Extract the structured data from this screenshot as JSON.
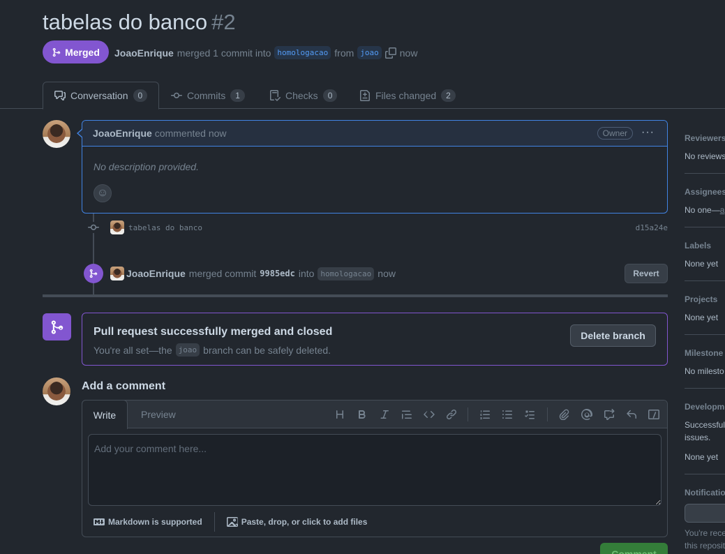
{
  "pr": {
    "title": "tabelas do banco",
    "number": "#2",
    "state": "Merged",
    "author": "JoaoEnrique",
    "merged_text": "merged 1 commit into",
    "base_branch": "homologacao",
    "from_text": "from",
    "head_branch": "joao",
    "time": "now"
  },
  "tabs": [
    {
      "label": "Conversation",
      "count": "0"
    },
    {
      "label": "Commits",
      "count": "1"
    },
    {
      "label": "Checks",
      "count": "0"
    },
    {
      "label": "Files changed",
      "count": "2"
    }
  ],
  "comment": {
    "author": "JoaoEnrique",
    "action": "commented now",
    "badge": "Owner",
    "body": "No description provided."
  },
  "commit": {
    "message": "tabelas do banco",
    "sha": "d15a24e"
  },
  "merge_event": {
    "author": "JoaoEnrique",
    "text1": "merged commit",
    "commit": "9985edc",
    "text2": "into",
    "branch": "homologacao",
    "time": "now",
    "revert_label": "Revert"
  },
  "merged_box": {
    "title": "Pull request successfully merged and closed",
    "desc_prefix": "You're all set—the",
    "branch": "joao",
    "desc_suffix": "branch can be safely deleted.",
    "delete_label": "Delete branch"
  },
  "add_comment": {
    "title": "Add a comment",
    "tab_write": "Write",
    "tab_preview": "Preview",
    "placeholder": "Add your comment here...",
    "markdown_note": "Markdown is supported",
    "attach_note": "Paste, drop, or click to add files",
    "submit_label": "Comment"
  },
  "sidebar": {
    "reviewers_title": "Reviewers",
    "reviewers_value": "No reviews",
    "assignees_title": "Assignees",
    "assignees_value": "No one—",
    "assignees_link": "a",
    "labels_title": "Labels",
    "labels_value": "None yet",
    "projects_title": "Projects",
    "projects_value": "None yet",
    "milestone_title": "Milestone",
    "milestone_value": "No milesto",
    "development_title": "Developme",
    "development_desc1": "Successfully",
    "development_desc2": "issues.",
    "development_value": "None yet",
    "notifications_title": "Notificatio",
    "notifications_desc1": "You're rece",
    "notifications_desc2": "this reposit"
  },
  "colors": {
    "merged_purple": "#8256d0",
    "link_blue": "#539bf5",
    "focus_blue": "#4184e4",
    "success_green": "#347d39"
  }
}
